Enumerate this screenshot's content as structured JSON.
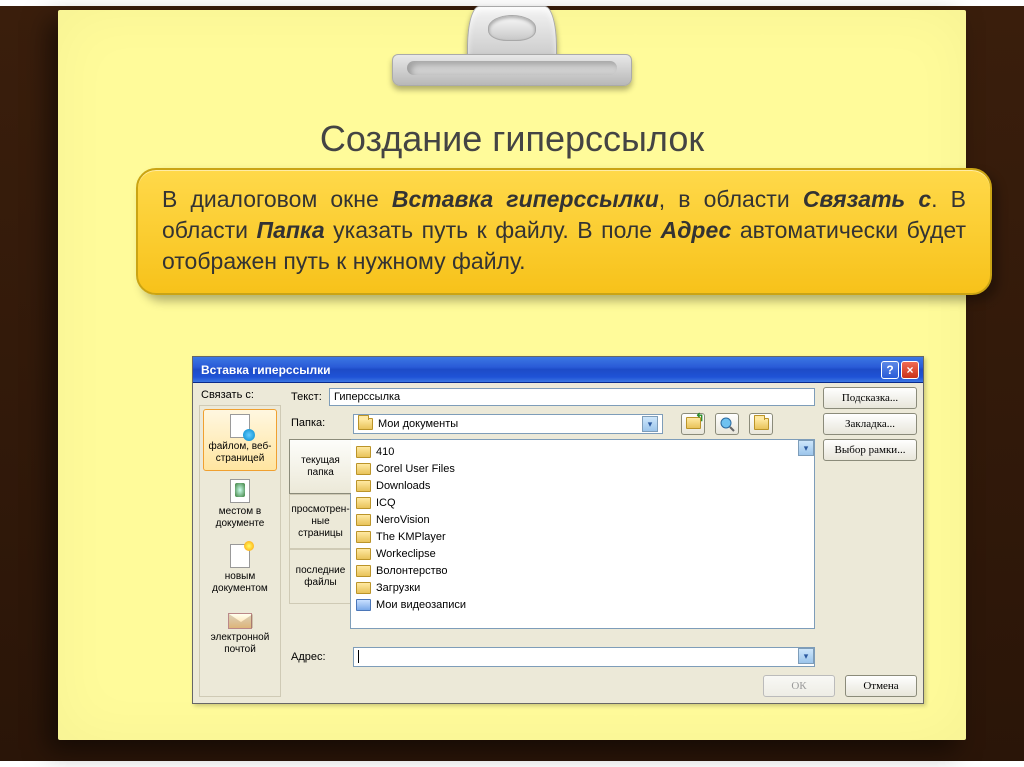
{
  "slide": {
    "title": "Создание гиперссылок",
    "callout_prefix": "В диалоговом окне ",
    "callout_b1": "Вставка гиперссылки",
    "callout_mid1": ", в области ",
    "callout_b2": "Связать с",
    "callout_mid2": ". В области ",
    "callout_b3": "Папка",
    "callout_mid3": " указать путь к файлу. В поле ",
    "callout_b4": "Адрес",
    "callout_suffix": " автоматически будет отображен путь к нужному файлу."
  },
  "dialog": {
    "title": "Вставка гиперссылки",
    "help": "?",
    "close": "×",
    "linkto_label": "Связать с:",
    "linkto": {
      "file_web": "файлом, веб-страницей",
      "place": "местом в документе",
      "newdoc": "новым документом",
      "email": "электронной почтой"
    },
    "text_label": "Текст:",
    "text_value": "Гиперссылка",
    "tip_btn": "Подсказка...",
    "folder_label": "Папка:",
    "folder_value": "Мои документы",
    "bookmark_btn": "Закладка...",
    "frame_btn": "Выбор рамки...",
    "browse_tabs": {
      "current": "текущая папка",
      "browsed": "просмотрен-ные страницы",
      "recent": "последние файлы"
    },
    "files": [
      "410",
      "Corel User Files",
      "Downloads",
      "ICQ",
      "NeroVision",
      "The KMPlayer",
      "Workeclipse",
      "Волонтерство",
      "Загрузки",
      "Мои видеозаписи"
    ],
    "addr_label": "Адрес:",
    "addr_value": "",
    "ok": "ОК",
    "cancel": "Отмена"
  }
}
